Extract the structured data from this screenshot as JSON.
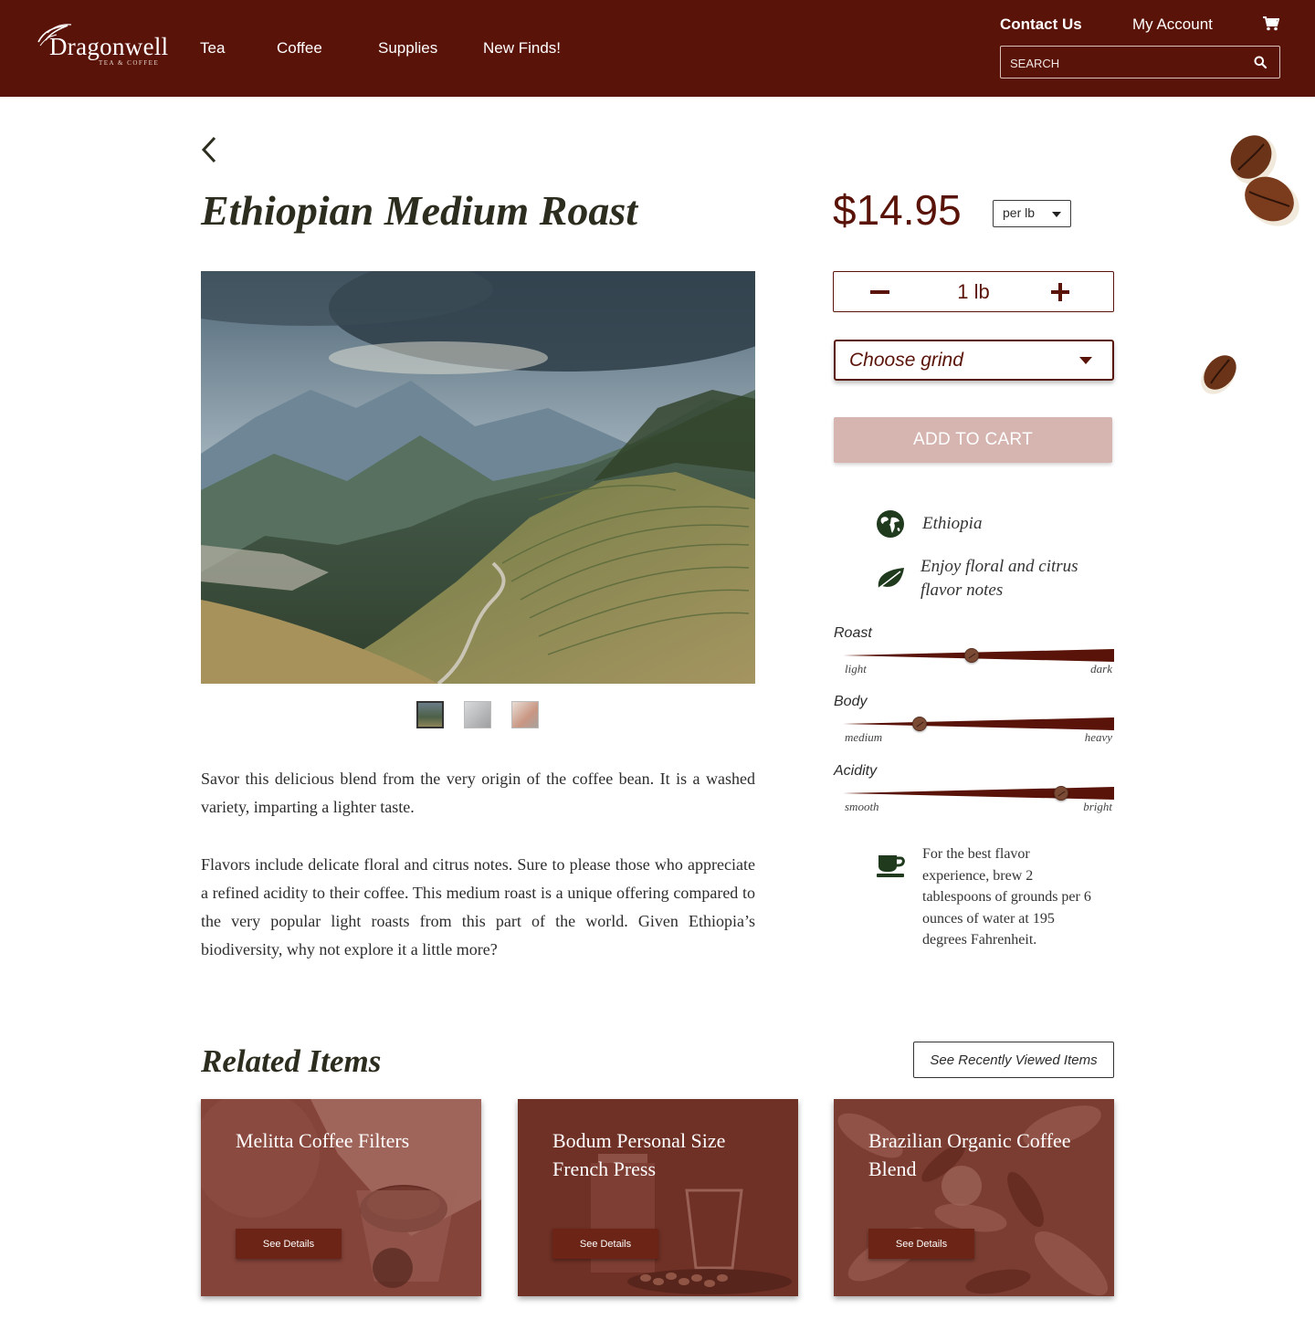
{
  "header": {
    "logo_text": "Dragonwell",
    "logo_sub": "TEA & COFFEE",
    "nav": [
      "Tea",
      "Coffee",
      "Supplies",
      "New Finds!"
    ],
    "contact": "Contact Us",
    "account": "My Account",
    "search_placeholder": "SEARCH"
  },
  "product": {
    "title": "Ethiopian Medium Roast",
    "price": "$14.95",
    "unit": "per lb",
    "quantity": "1 lb",
    "grind_placeholder": "Choose grind",
    "add_to_cart": "ADD TO CART",
    "origin": "Ethiopia",
    "flavor": "Enjoy floral and citrus flavor notes",
    "description": [
      "Savor this delicious blend from the very origin of the coffee bean.  It is a washed variety, imparting a lighter taste.",
      "Flavors include delicate floral and citrus notes.  Sure to please those who appreciate a refined acidity to their coffee.  This medium roast is a unique offering compared to the very popular light roasts from this part of the world.  Given Ethiopia’s biodiversity, why not explore it a little more?"
    ],
    "scales": [
      {
        "label": "Roast",
        "low": "light",
        "high": "dark",
        "value": 0.5
      },
      {
        "label": "Body",
        "low": "medium",
        "high": "heavy",
        "value": 0.3
      },
      {
        "label": "Acidity",
        "low": "smooth",
        "high": "bright",
        "value": 0.85
      }
    ],
    "brew_tip": "For the best flavor experience, brew 2 tablespoons of grounds per 6 ounces of water at 195 degrees Fahrenheit.",
    "thumbnail_count": 3
  },
  "related": {
    "title": "Related Items",
    "recent_button": "See Recently Viewed Items",
    "items": [
      {
        "title": "Melitta Coffee Filters",
        "button": "See Details"
      },
      {
        "title": "Bodum Personal Size French Press",
        "button": "See Details"
      },
      {
        "title": "Brazilian Organic Coffee Blend",
        "button": "See Details"
      }
    ]
  },
  "colors": {
    "brand": "#5a1308",
    "add_to_cart_bg": "#d6b4b0",
    "card_tint": "#7a3a30"
  },
  "icons": [
    "logo-swirl-icon",
    "search-icon",
    "cart-icon",
    "back-chevron-icon",
    "globe-icon",
    "leaf-icon",
    "coffee-cup-icon",
    "caret-down-icon",
    "minus-icon",
    "plus-icon"
  ]
}
